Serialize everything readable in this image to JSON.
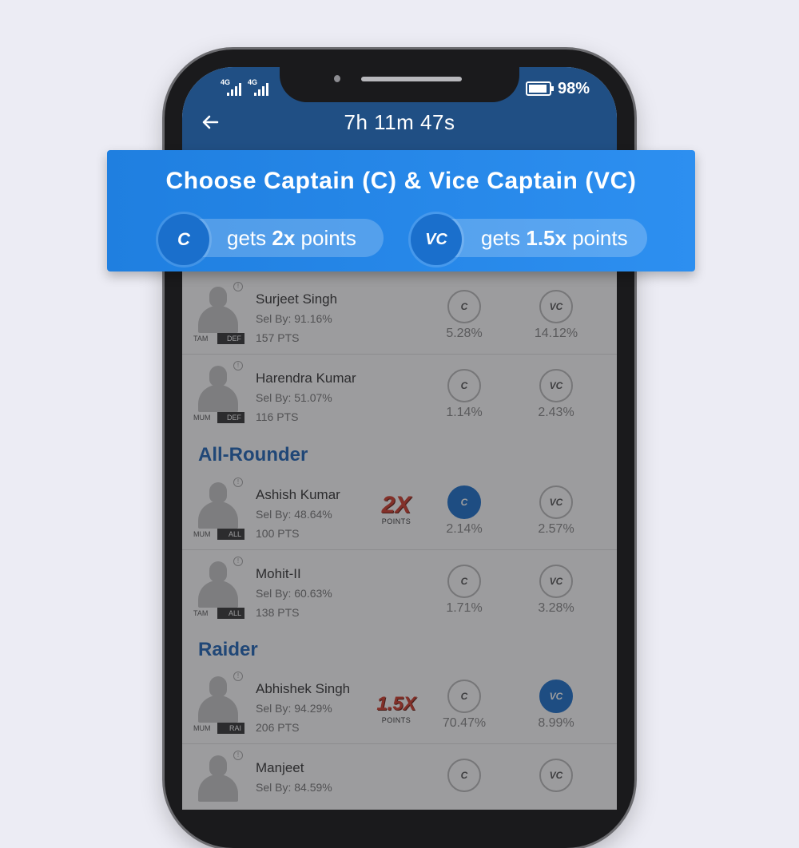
{
  "status": {
    "network_1": "4G",
    "network_2": "4G",
    "battery": "98%"
  },
  "header": {
    "timer": "7h 11m 47s"
  },
  "banner": {
    "title": "Choose Captain (C) & Vice Captain (VC)",
    "captain_symbol": "C",
    "captain_text_pre": "gets ",
    "captain_text_mult": "2x",
    "captain_text_post": " points",
    "vice_symbol": "VC",
    "vice_text_pre": "gets ",
    "vice_text_mult": "1.5x",
    "vice_text_post": " points"
  },
  "sections": {
    "allrounder": "All-Rounder",
    "raider": "Raider"
  },
  "players": [
    {
      "name": "Surjeet Singh",
      "sel": "Sel By: 91.16%",
      "pts": "157 PTS",
      "team": "TAM",
      "role": "DEF",
      "c_pct": "5.28%",
      "vc_pct": "14.12%"
    },
    {
      "name": "Harendra Kumar",
      "sel": "Sel By: 51.07%",
      "pts": "116 PTS",
      "team": "MUM",
      "role": "DEF",
      "c_pct": "1.14%",
      "vc_pct": "2.43%"
    },
    {
      "name": "Ashish Kumar",
      "sel": "Sel By: 48.64%",
      "pts": "100 PTS",
      "team": "MUM",
      "role": "ALL",
      "c_pct": "2.14%",
      "vc_pct": "2.57%",
      "multiplier": "2X",
      "multiplier_label": "POINTS"
    },
    {
      "name": "Mohit-II",
      "sel": "Sel By: 60.63%",
      "pts": "138 PTS",
      "team": "TAM",
      "role": "ALL",
      "c_pct": "1.71%",
      "vc_pct": "3.28%"
    },
    {
      "name": "Abhishek Singh",
      "sel": "Sel By: 94.29%",
      "pts": "206 PTS",
      "team": "MUM",
      "role": "RAI",
      "c_pct": "70.47%",
      "vc_pct": "8.99%",
      "multiplier": "1.5X",
      "multiplier_label": "POINTS"
    },
    {
      "name": "Manjeet",
      "sel": "Sel By: 84.59%",
      "pts": "",
      "team": "",
      "role": "",
      "c_pct": "",
      "vc_pct": ""
    }
  ],
  "buttons": {
    "c_label": "C",
    "vc_label": "VC"
  },
  "colors": {
    "brand_blue": "#1e73cf",
    "banner_blue": "#2d8ff0",
    "selected_blue": "#1a6fcc"
  }
}
